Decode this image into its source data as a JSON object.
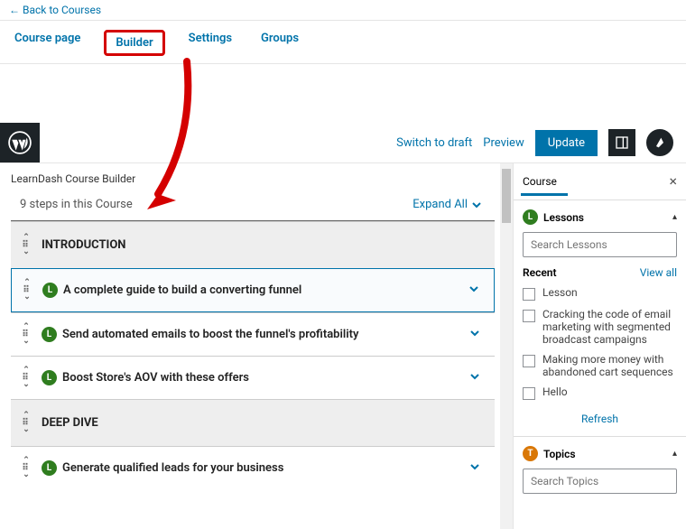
{
  "topnav": {
    "back": "Back to Courses"
  },
  "tabs": {
    "course_page": "Course page",
    "builder": "Builder",
    "settings": "Settings",
    "groups": "Groups"
  },
  "editor": {
    "switch_draft": "Switch to draft",
    "preview": "Preview",
    "update": "Update"
  },
  "builder": {
    "title": "LearnDash Course Builder",
    "steps": "9 steps in this Course",
    "expand_all": "Expand All",
    "sections": [
      {
        "type": "heading",
        "label": "INTRODUCTION"
      },
      {
        "type": "lesson",
        "label": "A complete guide to build a converting funnel",
        "selected": true
      },
      {
        "type": "lesson",
        "label": "Send automated emails to boost the funnel's profitability"
      },
      {
        "type": "lesson",
        "label": "Boost Store's AOV with these offers"
      },
      {
        "type": "heading",
        "label": "DEEP DIVE"
      },
      {
        "type": "lesson",
        "label": "Generate qualified leads for your business"
      }
    ]
  },
  "sidebar": {
    "tab": "Course",
    "lessons": {
      "label": "Lessons",
      "search_placeholder": "Search Lessons",
      "recent": "Recent",
      "view_all": "View all",
      "items": [
        "Lesson",
        "Cracking the code of email marketing with segmented broadcast campaigns",
        "Making more money with abandoned cart sequences",
        "Hello"
      ],
      "refresh": "Refresh"
    },
    "topics": {
      "label": "Topics",
      "search_placeholder": "Search Topics"
    }
  }
}
